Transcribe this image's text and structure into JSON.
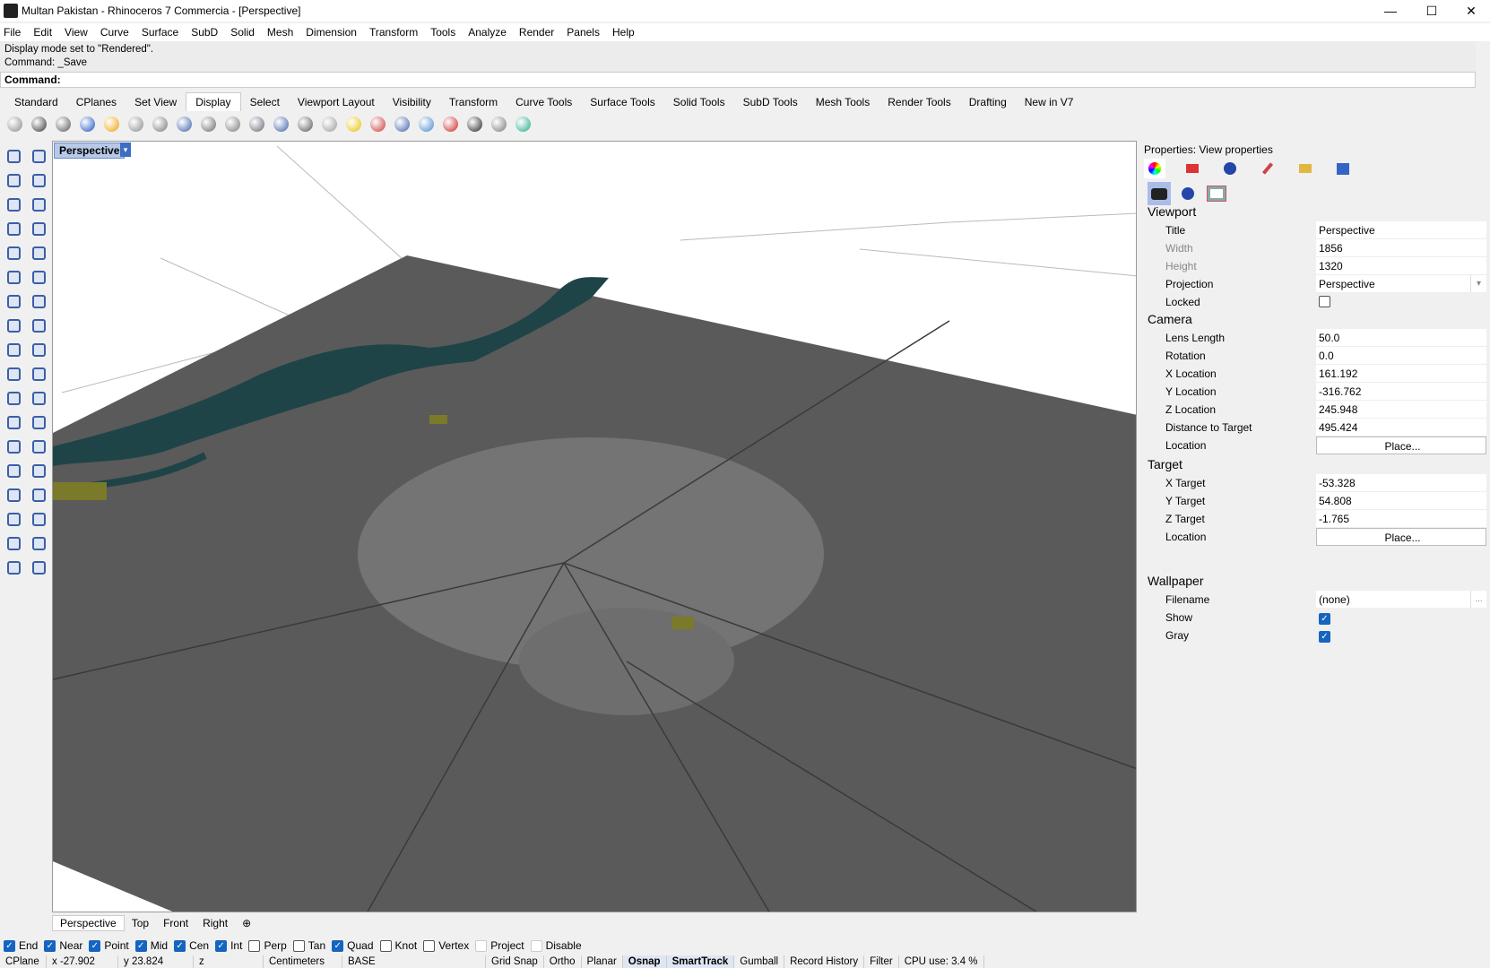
{
  "window": {
    "title": "Multan Pakistan - Rhinoceros 7 Commercia - [Perspective]",
    "minimize": "—",
    "maximize": "☐",
    "close": "✕"
  },
  "menu": [
    "File",
    "Edit",
    "View",
    "Curve",
    "Surface",
    "SubD",
    "Solid",
    "Mesh",
    "Dimension",
    "Transform",
    "Tools",
    "Analyze",
    "Render",
    "Panels",
    "Help"
  ],
  "history": [
    "Display mode set to \"Rendered\".",
    "Command: _Save"
  ],
  "command": {
    "label": "Command:",
    "value": ""
  },
  "toolbar_tabs": [
    "Standard",
    "CPlanes",
    "Set View",
    "Display",
    "Select",
    "Viewport Layout",
    "Visibility",
    "Transform",
    "Curve Tools",
    "Surface Tools",
    "Solid Tools",
    "SubD Tools",
    "Mesh Tools",
    "Render Tools",
    "Drafting",
    "New in V7"
  ],
  "active_tab": "Display",
  "viewport": {
    "label": "Perspective",
    "dropdown": "▾"
  },
  "viewport_tabs": [
    "Perspective",
    "Top",
    "Front",
    "Right",
    "⊕"
  ],
  "osnap": [
    {
      "label": "End",
      "on": true
    },
    {
      "label": "Near",
      "on": true
    },
    {
      "label": "Point",
      "on": true
    },
    {
      "label": "Mid",
      "on": true
    },
    {
      "label": "Cen",
      "on": true
    },
    {
      "label": "Int",
      "on": true
    },
    {
      "label": "Perp",
      "on": false
    },
    {
      "label": "Tan",
      "on": false
    },
    {
      "label": "Quad",
      "on": true
    },
    {
      "label": "Knot",
      "on": false
    },
    {
      "label": "Vertex",
      "on": false
    },
    {
      "label": "Project",
      "on": false
    },
    {
      "label": "Disable",
      "on": false
    }
  ],
  "status": {
    "cplane": "CPlane",
    "x": "x -27.902",
    "y": "y 23.824",
    "z": "z",
    "units": "Centimeters",
    "layer": "BASE",
    "grid_snap": "Grid Snap",
    "ortho": "Ortho",
    "planar": "Planar",
    "osnap": "Osnap",
    "smarttrack": "SmartTrack",
    "gumball": "Gumball",
    "record_history": "Record History",
    "filter": "Filter",
    "cpu": "CPU use: 3.4 %"
  },
  "panel": {
    "title": "Properties: View properties",
    "viewport_heading": "Viewport",
    "title_label": "Title",
    "title_value": "Perspective",
    "width_label": "Width",
    "width_value": "1856",
    "height_label": "Height",
    "height_value": "1320",
    "projection_label": "Projection",
    "projection_value": "Perspective",
    "locked_label": "Locked",
    "locked": false,
    "camera_heading": "Camera",
    "lens_label": "Lens Length",
    "lens_value": "50.0",
    "rotation_label": "Rotation",
    "rotation_value": "0.0",
    "xloc_label": "X Location",
    "xloc_value": "161.192",
    "yloc_label": "Y Location",
    "yloc_value": "-316.762",
    "zloc_label": "Z Location",
    "zloc_value": "245.948",
    "dist_label": "Distance to Target",
    "dist_value": "495.424",
    "camloc_label": "Location",
    "place_button": "Place...",
    "target_heading": "Target",
    "xt_label": "X Target",
    "xt_value": "-53.328",
    "yt_label": "Y Target",
    "yt_value": "54.808",
    "zt_label": "Z Target",
    "zt_value": "-1.765",
    "tloc_label": "Location",
    "wallpaper_heading": "Wallpaper",
    "filename_label": "Filename",
    "filename_value": "(none)",
    "browse": "...",
    "show_label": "Show",
    "show": true,
    "gray_label": "Gray",
    "gray": true
  }
}
